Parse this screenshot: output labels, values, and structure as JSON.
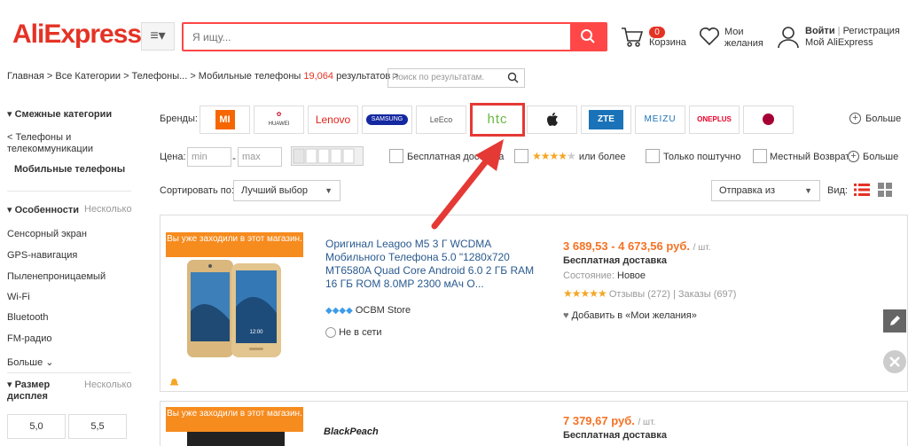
{
  "header": {
    "logo": "AliExpress",
    "search_placeholder": "Я ищу...",
    "cart_count": "0",
    "cart_label": "Корзина",
    "wishlist_label": "Мои желания",
    "login_label": "Войти",
    "register_label": "Регистрация",
    "my_account": "Мой AliExpress"
  },
  "breadcrumb": {
    "path": "Главная > Все Категории > Телефоны... > Мобильные телефоны",
    "count": "19,064",
    "results_label": "результатов >",
    "search_placeholder": "Поиск по результатам."
  },
  "sidebar": {
    "related_title": "Смежные категории",
    "cat_parent": "< Телефоны и телекоммуникации",
    "cat_current": "Мобильные телефоны",
    "features_title": "Особенности",
    "multi_label": "Несколько",
    "features": [
      "Сенсорный экран",
      "GPS-навигация",
      "Пыленепроницаемый",
      "Wi-Fi",
      "Bluetooth",
      "FM-радио"
    ],
    "more_label": "Больше",
    "size_title": "Размер дисплея",
    "size_multi": "Несколько",
    "sizes": [
      "5,0",
      "5,5"
    ]
  },
  "filters": {
    "brands_label": "Бренды:",
    "brands": [
      "MI",
      "HUAWEI",
      "Lenovo",
      "SAMSUNG",
      "LeEco",
      "htc",
      "",
      "ZTE",
      "MEIZU",
      "ONEPLUS",
      "LG"
    ],
    "brands_more": "Больше",
    "price_label": "Цена:",
    "price_min": "min",
    "price_max": "max",
    "price_dash": "-",
    "free_shipping": "Бесплатная доставка",
    "rating_more": "или более",
    "single_only": "Только поштучно",
    "local_return": "Местный Возврат",
    "options_more": "Больше",
    "sort_label": "Сортировать по:",
    "sort_value": "Лучший выбор",
    "ship_from": "Отправка из",
    "view_label": "Вид:"
  },
  "products": [
    {
      "visited": "Вы уже заходили в этот магазин.",
      "title": "Оригинал Leagoo M5 3 Г WCDMA Мобильного Телефона 5.0 \"1280x720 MT6580A Quad Core Android 6.0 2 ГБ RAM 16 ГБ ROM 8.0MP 2300 мАч О...",
      "price": "3 689,53 - 4 673,56 руб.",
      "unit": "/ шт.",
      "shipping": "Бесплатная доставка",
      "condition_label": "Состояние:",
      "condition": "Новое",
      "reviews": "Отзывы (272)",
      "orders": "Заказы (697)",
      "wishlist": "Добавить в «Мои желания»",
      "store": "OCBM Store",
      "online": "Не в сети"
    },
    {
      "visited": "Вы уже заходили в этот магазин.",
      "price": "7 379,67 руб.",
      "unit": "/ шт.",
      "shipping": "Бесплатная доставка",
      "brand_logo": "BlackPeach"
    }
  ],
  "colors": {
    "accent": "#ff4747",
    "logo": "#e43225",
    "price": "#f57224",
    "tag": "#f68b1e",
    "link": "#2a5a8f",
    "highlight": "#e53935"
  }
}
